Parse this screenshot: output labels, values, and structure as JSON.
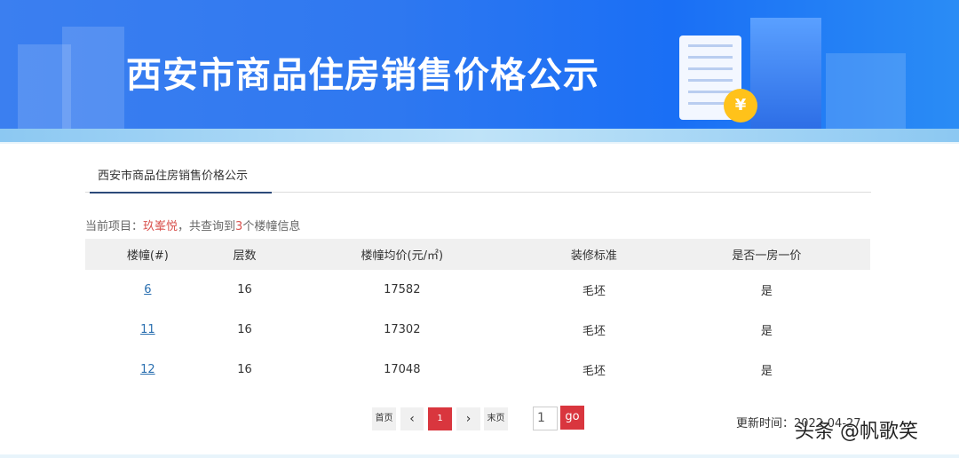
{
  "banner": {
    "title": "西安市商品住房销售价格公示",
    "coin_symbol": "¥"
  },
  "tab": {
    "label": "西安市商品住房销售价格公示"
  },
  "info": {
    "prefix": "当前项目：",
    "project": "玖峯悦",
    "mid": "，共查询到",
    "count": "3",
    "suffix": "个楼幢信息"
  },
  "table": {
    "headers": [
      "楼幢(#)",
      "层数",
      "楼幢均价(元/㎡)",
      "装修标准",
      "是否一房一价"
    ],
    "rows": [
      [
        "6",
        "16",
        "17582",
        "毛坯",
        "是"
      ],
      [
        "11",
        "16",
        "17302",
        "毛坯",
        "是"
      ],
      [
        "12",
        "16",
        "17048",
        "毛坯",
        "是"
      ]
    ]
  },
  "pager": {
    "first": "首页",
    "prev": "‹",
    "current": "1",
    "next": "›",
    "last": "末页",
    "input": "1",
    "go": "go"
  },
  "update": "更新时间：2022-04-27",
  "watermark": "头条 @帆歌笑"
}
